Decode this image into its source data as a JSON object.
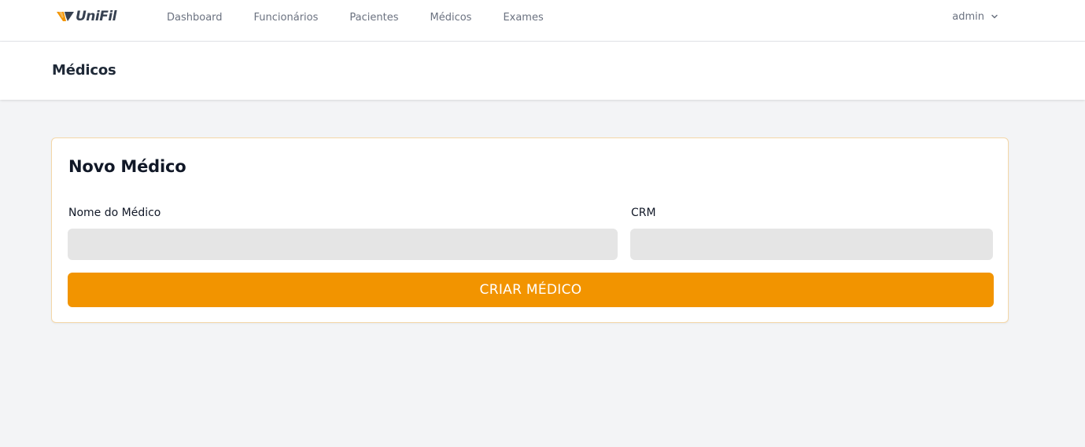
{
  "brand": {
    "name": "UniFil",
    "accent": "#f29400"
  },
  "nav": {
    "links": [
      {
        "label": "Dashboard"
      },
      {
        "label": "Funcionários"
      },
      {
        "label": "Pacientes"
      },
      {
        "label": "Médicos"
      },
      {
        "label": "Exames"
      }
    ],
    "user": {
      "name": "admin",
      "icon": "chevron-down-icon"
    }
  },
  "page": {
    "title": "Médicos"
  },
  "form": {
    "title": "Novo Médico",
    "fields": {
      "nome": {
        "label": "Nome do Médico",
        "value": ""
      },
      "crm": {
        "label": "CRM",
        "value": ""
      }
    },
    "submit_label": "CRIAR MÉDICO"
  }
}
